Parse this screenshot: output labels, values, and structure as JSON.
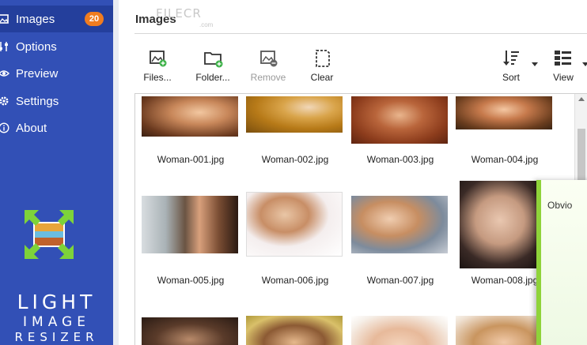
{
  "sidebar": {
    "items": [
      {
        "label": "Images",
        "icon": "images-icon",
        "badge": "20",
        "active": true
      },
      {
        "label": "Options",
        "icon": "sliders-icon"
      },
      {
        "label": "Preview",
        "icon": "eye-icon"
      },
      {
        "label": "Settings",
        "icon": "gear-icon"
      },
      {
        "label": "About",
        "icon": "info-icon"
      }
    ],
    "brand": {
      "line1": "LIGHT",
      "line2": "IMAGE",
      "line3": "RESIZER"
    }
  },
  "header": {
    "title": "Images",
    "watermark": "FILECR",
    "watermark_sub": ".com"
  },
  "toolbar": {
    "files": "Files...",
    "folder": "Folder...",
    "remove": "Remove",
    "clear": "Clear",
    "sort": "Sort",
    "view": "View"
  },
  "files": [
    {
      "name": "Woman-001.jpg"
    },
    {
      "name": "Woman-002.jpg"
    },
    {
      "name": "Woman-003.jpg"
    },
    {
      "name": "Woman-004.jpg"
    },
    {
      "name": "Woman-005.jpg"
    },
    {
      "name": "Woman-006.jpg"
    },
    {
      "name": "Woman-007.jpg"
    },
    {
      "name": "Woman-008.jpg"
    }
  ],
  "dialog": {
    "text": "Obvio"
  },
  "colors": {
    "sidebar": "#3250b6",
    "badge": "#f07c1f",
    "accent_green": "#8fd33a"
  }
}
